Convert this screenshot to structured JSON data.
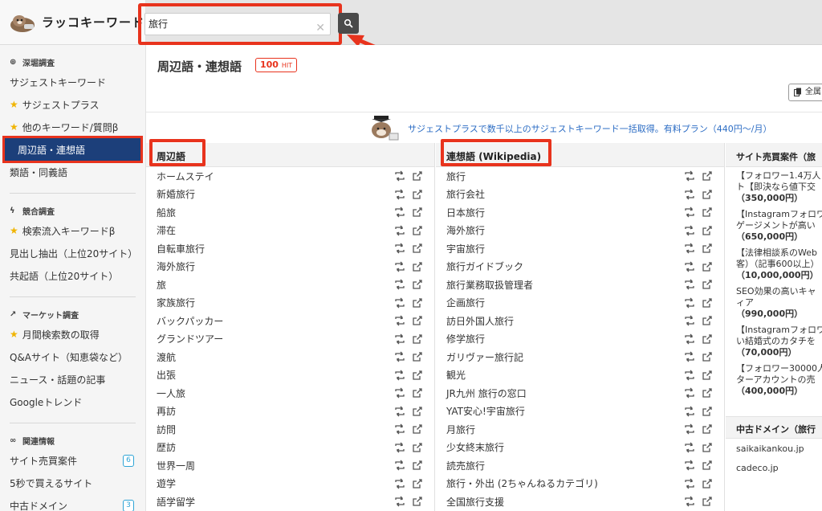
{
  "app": {
    "name": "ラッコキーワード"
  },
  "search": {
    "value": "旅行"
  },
  "sidebar": {
    "sections": [
      {
        "title": "深堀調査",
        "items": [
          {
            "label": "サジェストキーワード",
            "star": false
          },
          {
            "label": "サジェストプラス",
            "star": true
          },
          {
            "label": "他のキーワード/質問β",
            "star": true
          },
          {
            "label": "周辺語・連想語",
            "star": false,
            "active": true
          },
          {
            "label": "類語・同義語",
            "star": false
          }
        ]
      },
      {
        "title": "競合調査",
        "items": [
          {
            "label": "検索流入キーワードβ",
            "star": true
          },
          {
            "label": "見出し抽出（上位20サイト）",
            "star": false
          },
          {
            "label": "共起語（上位20サイト）",
            "star": false
          }
        ]
      },
      {
        "title": "マーケット調査",
        "items": [
          {
            "label": "月間検索数の取得",
            "star": true
          },
          {
            "label": "Q&Aサイト（知恵袋など）",
            "star": false
          },
          {
            "label": "ニュース・話題の記事",
            "star": false
          },
          {
            "label": "Googleトレンド",
            "star": false
          }
        ]
      },
      {
        "title": "関連情報",
        "items": [
          {
            "label": "サイト売買案件",
            "star": false,
            "badge": "6"
          },
          {
            "label": "5秒で買えるサイト",
            "star": false
          },
          {
            "label": "中古ドメイン",
            "star": false,
            "badge": "3"
          }
        ]
      }
    ]
  },
  "header": {
    "title": "周辺語・連想語",
    "hit_count": "100",
    "hit_unit": "HIT",
    "all_button": "全属"
  },
  "promo": {
    "text": "サジェストプラスで数千以上のサジェストキーワード一括取得。有料プラン（440円〜/月）"
  },
  "left_column": {
    "title": "周辺語",
    "items": [
      "ホームステイ",
      "新婚旅行",
      "船旅",
      "滞在",
      "自転車旅行",
      "海外旅行",
      "旅",
      "家族旅行",
      "バックパッカー",
      "グランドツアー",
      "渡航",
      "出張",
      "一人旅",
      "再訪",
      "訪問",
      "歴訪",
      "世界一周",
      "遊学",
      "語学留学"
    ]
  },
  "mid_column": {
    "title": "連想語 (Wikipedia)",
    "items": [
      "旅行",
      "旅行会社",
      "日本旅行",
      "海外旅行",
      "宇宙旅行",
      "旅行ガイドブック",
      "旅行業務取扱管理者",
      "企画旅行",
      "訪日外国人旅行",
      "修学旅行",
      "ガリヴァー旅行記",
      "観光",
      "JR九州 旅行の窓口",
      "YAT安心!宇宙旅行",
      "月旅行",
      "少女終末旅行",
      "読売旅行",
      "旅行・外出 (2ちゃんねるカテゴリ)",
      "全国旅行支援"
    ]
  },
  "right_column": {
    "title": "サイト売買案件（旅",
    "deals": [
      {
        "lines": [
          "【フォロワー1.4万人",
          "ト【即決なら値下交"
        ],
        "price": "（350,000円）"
      },
      {
        "lines": [
          "【Instagramフォロワ",
          "ゲージメントが高い"
        ],
        "price": "（650,000円）"
      },
      {
        "lines": [
          "【法律相談系のWeb",
          "客）（記事600以上）"
        ],
        "price": "（10,000,000円）"
      },
      {
        "lines": [
          "SEO効果の高いキャ",
          "ィア"
        ],
        "price": "（990,000円）"
      },
      {
        "lines": [
          "【Instagramフォロワ",
          "い結婚式のカタチを"
        ],
        "price": "（70,000円）"
      },
      {
        "lines": [
          "【フォロワー30000人",
          "ターアカウントの売"
        ],
        "price": "（400,000円）"
      }
    ],
    "domain_title": "中古ドメイン（旅行",
    "domains": [
      "saikaikankou.jp",
      "cadeco.jp"
    ]
  },
  "colors": {
    "accent": "#e8331d",
    "active_nav": "#1c3f7a",
    "link": "#2b6cc4",
    "star": "#f0b400"
  }
}
